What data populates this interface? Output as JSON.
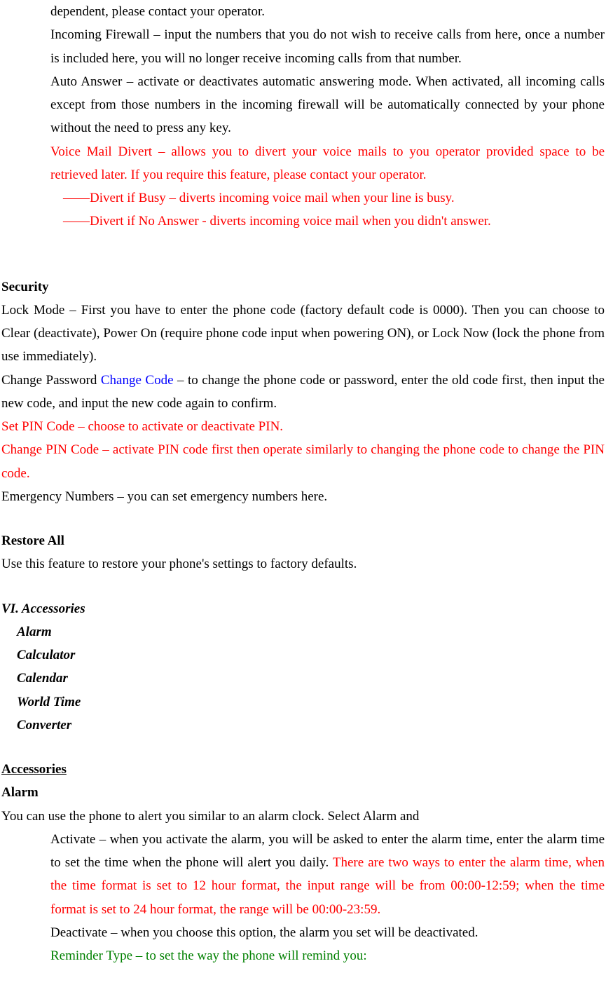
{
  "para1": "dependent, please contact your operator.",
  "para2": "Incoming Firewall – input the numbers that you do not wish to receive calls from here, once a number is included here, you will no longer receive incoming calls from that number.",
  "para3": "Auto Answer – activate or deactivates automatic answering mode. When activated, all incoming calls except from those numbers in the incoming firewall will be automatically connected by your phone without the need to press any key.",
  "para4": "Voice Mail Divert – allows you to divert your voice mails to you operator provided space to be retrieved later. If you require this feature, please contact your operator.",
  "para5": "——Divert if Busy – diverts incoming voice mail when your line is busy.",
  "para6": "——Divert if No Answer - diverts incoming voice mail when you didn't answer.",
  "security": {
    "heading": "Security",
    "lockMode": "Lock Mode – First you have to enter the phone code (factory default code is 0000). Then you can choose to Clear (deactivate), Power On (require phone code input when powering ON), or Lock Now (lock the phone from use immediately).",
    "changePassword1": "Change Password ",
    "changeCode": "Change Code",
    "changePassword2": " – to change the phone code or password, enter the old code first, then input the new code, and input the new code again to confirm.",
    "setPin": "Set PIN Code – choose to activate or deactivate PIN.",
    "changePin": "Change PIN Code – activate PIN code first then operate similarly to changing the phone code to change the PIN code.",
    "emergency": "Emergency Numbers – you can set emergency numbers here."
  },
  "restore": {
    "heading": "Restore All",
    "text": "Use this feature to restore your phone's settings to factory defaults."
  },
  "accessories": {
    "heading": "VI. Accessories",
    "items": {
      "alarm": "Alarm",
      "calculator": "Calculator",
      "calendar": "Calendar",
      "worldTime": "World Time",
      "converter": "Converter"
    },
    "sectionHeading": "Accessories",
    "alarmSection": {
      "heading": "Alarm",
      "intro": "You can use the phone to alert you similar to an alarm clock. Select Alarm and",
      "activate1": "Activate – when you activate the alarm, you will be asked to enter the alarm time, enter the alarm time to set the time when the phone will alert you daily. ",
      "activate2": "There are two ways to enter the alarm time, when the time format is set to 12 hour format, the input range will be from 00:00-12:59; when the time format is set to 24 hour format, the range will be 00:00-23:59.",
      "deactivate": "Deactivate – when you choose this option, the alarm you set will be deactivated.",
      "reminder": "Reminder Type – to set the way the phone will remind you:"
    }
  }
}
